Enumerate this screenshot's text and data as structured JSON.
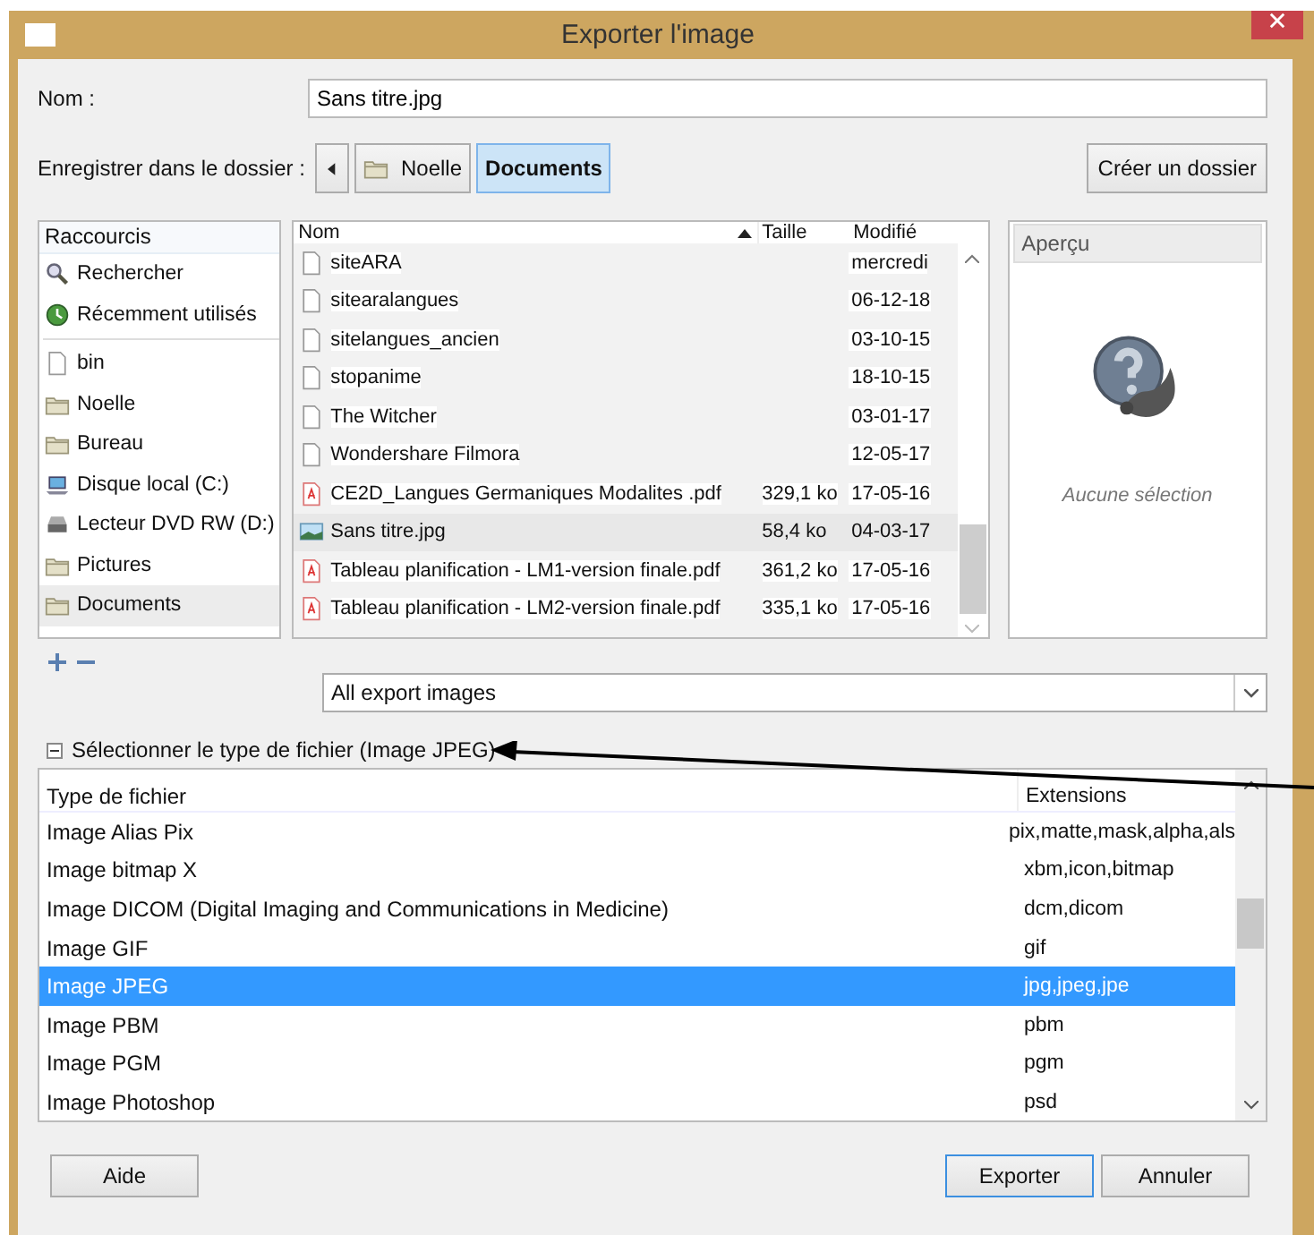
{
  "window": {
    "title": "Exporter l'image"
  },
  "name_field": {
    "label": "Nom :",
    "value": "Sans titre.jpg"
  },
  "location": {
    "label": "Enregistrer dans le dossier :",
    "path": [
      {
        "label": "Noelle",
        "selected": false
      },
      {
        "label": "Documents",
        "selected": true
      }
    ],
    "create_folder": "Créer un dossier"
  },
  "shortcuts": {
    "header": "Raccourcis",
    "places": [
      {
        "label": "Rechercher",
        "kind": "search",
        "selected": false
      },
      {
        "label": "Récemment utilisés",
        "kind": "recent",
        "selected": false
      }
    ],
    "bookmarks": [
      {
        "label": "bin",
        "kind": "file",
        "selected": false
      },
      {
        "label": "Noelle",
        "kind": "folder",
        "selected": false
      },
      {
        "label": "Bureau",
        "kind": "folder",
        "selected": false
      },
      {
        "label": "Disque local (C:)",
        "kind": "disk",
        "selected": false
      },
      {
        "label": "Lecteur DVD RW (D:)",
        "kind": "dvd",
        "selected": false
      },
      {
        "label": "Pictures",
        "kind": "folder",
        "selected": false
      },
      {
        "label": "Documents",
        "kind": "folder",
        "selected": true
      }
    ]
  },
  "files": {
    "columns": [
      {
        "label": "Nom",
        "sorted": true
      },
      {
        "label": "Taille",
        "sorted": false
      },
      {
        "label": "Modifié",
        "sorted": false
      }
    ],
    "rows": [
      {
        "name": "siteARA",
        "kind": "file",
        "size": "",
        "modified": "mercredi",
        "selected": false
      },
      {
        "name": "sitearalangues",
        "kind": "file",
        "size": "",
        "modified": "06-12-18",
        "selected": false
      },
      {
        "name": "sitelangues_ancien",
        "kind": "file",
        "size": "",
        "modified": "03-10-15",
        "selected": false
      },
      {
        "name": "stopanime",
        "kind": "file",
        "size": "",
        "modified": "18-10-15",
        "selected": false
      },
      {
        "name": "The Witcher",
        "kind": "file",
        "size": "",
        "modified": "03-01-17",
        "selected": false
      },
      {
        "name": "Wondershare Filmora",
        "kind": "file",
        "size": "",
        "modified": "12-05-17",
        "selected": false
      },
      {
        "name": "CE2D_Langues Germaniques Modalites .pdf",
        "kind": "pdf",
        "size": "329,1 ko",
        "modified": "17-05-16",
        "selected": false
      },
      {
        "name": "Sans titre.jpg",
        "kind": "image",
        "size": "58,4 ko",
        "modified": "04-03-17",
        "selected": true
      },
      {
        "name": "Tableau planification - LM1-version finale.pdf",
        "kind": "pdf",
        "size": "361,2 ko",
        "modified": "17-05-16",
        "selected": false
      },
      {
        "name": "Tableau planification - LM2-version finale.pdf",
        "kind": "pdf",
        "size": "335,1 ko",
        "modified": "17-05-16",
        "selected": false
      }
    ]
  },
  "preview": {
    "header": "Aperçu",
    "message": "Aucune sélection"
  },
  "filter": {
    "value": "All export images"
  },
  "file_type": {
    "label": "Sélectionner le type de fichier (Image JPEG)",
    "expanded": true,
    "columns": [
      "Type de fichier",
      "Extensions"
    ],
    "rows": [
      {
        "type": "Image Alias Pix",
        "extensions": "pix,matte,mask,alpha,als",
        "selected": false
      },
      {
        "type": "Image bitmap X",
        "extensions": "xbm,icon,bitmap",
        "selected": false
      },
      {
        "type": "Image DICOM (Digital Imaging and Communications in Medicine)",
        "extensions": "dcm,dicom",
        "selected": false
      },
      {
        "type": "Image GIF",
        "extensions": "gif",
        "selected": false
      },
      {
        "type": "Image JPEG",
        "extensions": "jpg,jpeg,jpe",
        "selected": true
      },
      {
        "type": "Image PBM",
        "extensions": "pbm",
        "selected": false
      },
      {
        "type": "Image PGM",
        "extensions": "pgm",
        "selected": false
      },
      {
        "type": "Image Photoshop",
        "extensions": "psd",
        "selected": false
      }
    ]
  },
  "buttons": [
    {
      "label": "Aide",
      "default": false
    },
    {
      "label": "Exporter",
      "default": true
    },
    {
      "label": "Annuler",
      "default": false
    }
  ]
}
